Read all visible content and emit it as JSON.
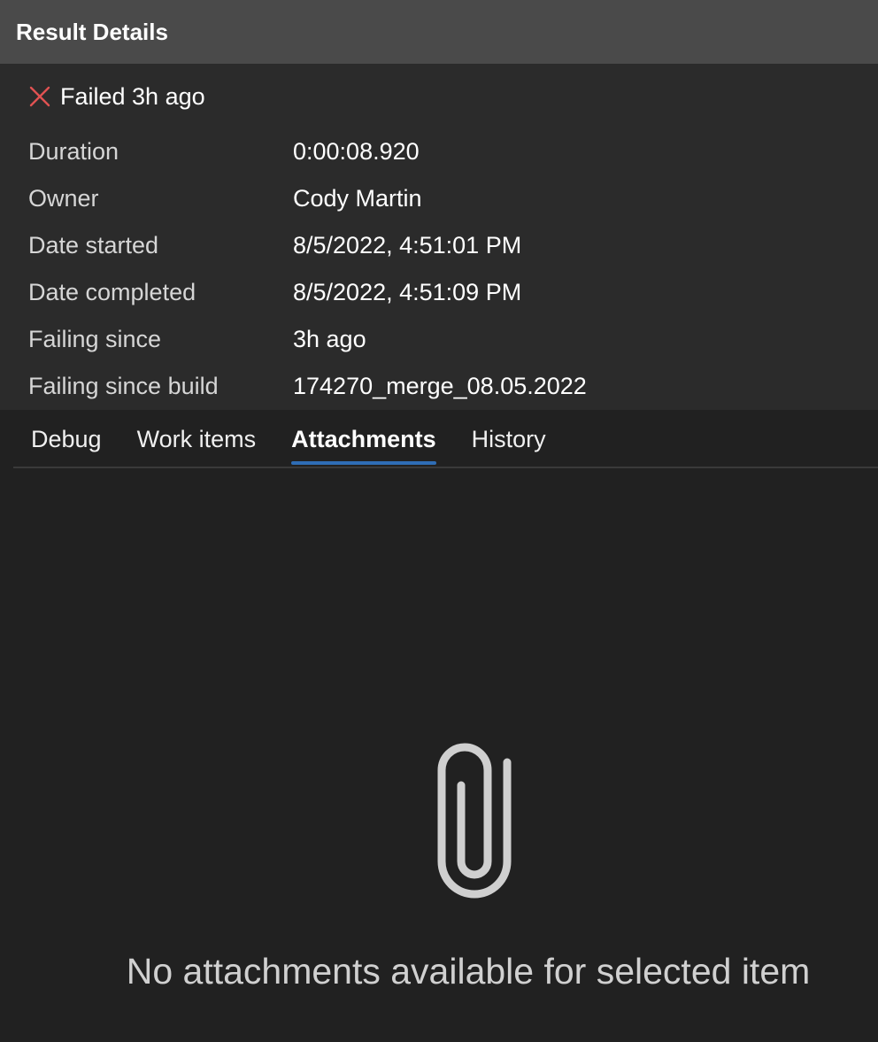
{
  "window": {
    "title": "Result Details"
  },
  "status": {
    "icon": "close-icon",
    "text": "Failed 3h ago",
    "color": "#e05252"
  },
  "properties": [
    {
      "label": "Duration",
      "value": "0:00:08.920"
    },
    {
      "label": "Owner",
      "value": "Cody Martin"
    },
    {
      "label": "Date started",
      "value": "8/5/2022, 4:51:01 PM"
    },
    {
      "label": "Date completed",
      "value": "8/5/2022, 4:51:09 PM"
    },
    {
      "label": "Failing since",
      "value": "3h ago"
    },
    {
      "label": "Failing since build",
      "value": "174270_merge_08.05.2022"
    }
  ],
  "tabs": [
    {
      "label": "Debug",
      "active": false
    },
    {
      "label": "Work items",
      "active": false
    },
    {
      "label": "Attachments",
      "active": true
    },
    {
      "label": "History",
      "active": false
    }
  ],
  "attachments": {
    "icon": "paperclip-icon",
    "empty_message": "No attachments available for selected item"
  },
  "colors": {
    "accent": "#2f6db5",
    "titlebar": "#4a4a4a",
    "background": "#212121",
    "summary_background": "#2b2b2b"
  }
}
